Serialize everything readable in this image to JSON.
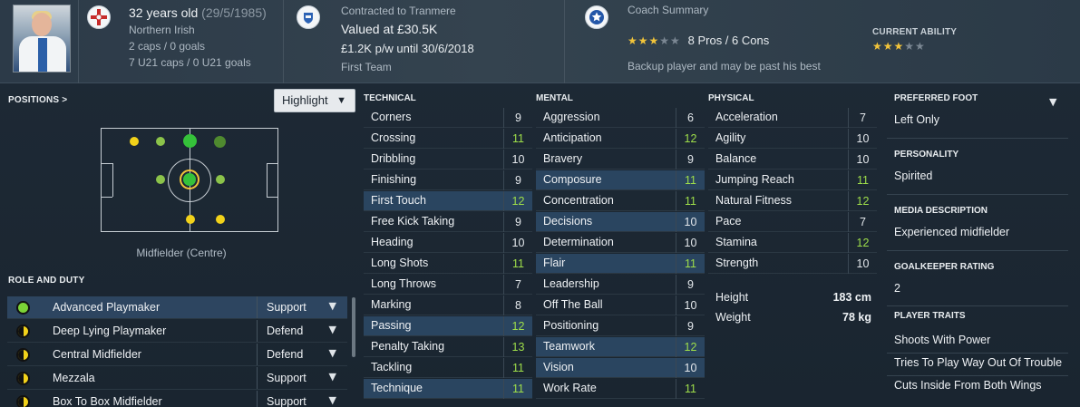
{
  "header": {
    "age": "32 years old",
    "dob": "(29/5/1985)",
    "nationality": "Northern Irish",
    "caps": "2 caps / 0 goals",
    "u21_caps": "7 U21 caps / 0 U21 goals",
    "contract_label": "Contracted to Tranmere",
    "value": "Valued at £30.5K",
    "wage": "£1.2K p/w until 30/6/2018",
    "squad": "First Team",
    "coach_title": "Coach Summary",
    "coach_stars": 3,
    "pros_cons": "8 Pros / 6 Cons",
    "coach_note": "Backup player and may be past his best",
    "ability_label": "CURRENT ABILITY",
    "ability_stars": 3
  },
  "positions": {
    "label": "POSITIONS",
    "label_chevron": ">",
    "highlight": "Highlight",
    "position_name": "Midfielder (Centre)"
  },
  "role": {
    "label": "ROLE AND DUTY",
    "roles": [
      {
        "name": "Advanced Playmaker",
        "duty": "Support"
      },
      {
        "name": "Deep Lying Playmaker",
        "duty": "Defend"
      },
      {
        "name": "Central Midfielder",
        "duty": "Defend"
      },
      {
        "name": "Mezzala",
        "duty": "Support"
      },
      {
        "name": "Box To Box Midfielder",
        "duty": "Support"
      }
    ]
  },
  "technical": {
    "label": "TECHNICAL",
    "attrs": [
      {
        "name": "Corners",
        "value": "9"
      },
      {
        "name": "Crossing",
        "value": "11"
      },
      {
        "name": "Dribbling",
        "value": "10"
      },
      {
        "name": "Finishing",
        "value": "9"
      },
      {
        "name": "First Touch",
        "value": "12"
      },
      {
        "name": "Free Kick Taking",
        "value": "9"
      },
      {
        "name": "Heading",
        "value": "10"
      },
      {
        "name": "Long Shots",
        "value": "11"
      },
      {
        "name": "Long Throws",
        "value": "7"
      },
      {
        "name": "Marking",
        "value": "8"
      },
      {
        "name": "Passing",
        "value": "12"
      },
      {
        "name": "Penalty Taking",
        "value": "13"
      },
      {
        "name": "Tackling",
        "value": "11"
      },
      {
        "name": "Technique",
        "value": "11"
      }
    ]
  },
  "mental": {
    "label": "MENTAL",
    "attrs": [
      {
        "name": "Aggression",
        "value": "6"
      },
      {
        "name": "Anticipation",
        "value": "12"
      },
      {
        "name": "Bravery",
        "value": "9"
      },
      {
        "name": "Composure",
        "value": "11"
      },
      {
        "name": "Concentration",
        "value": "11"
      },
      {
        "name": "Decisions",
        "value": "10"
      },
      {
        "name": "Determination",
        "value": "10"
      },
      {
        "name": "Flair",
        "value": "11"
      },
      {
        "name": "Leadership",
        "value": "9"
      },
      {
        "name": "Off The Ball",
        "value": "10"
      },
      {
        "name": "Positioning",
        "value": "9"
      },
      {
        "name": "Teamwork",
        "value": "12"
      },
      {
        "name": "Vision",
        "value": "10"
      },
      {
        "name": "Work Rate",
        "value": "11"
      }
    ]
  },
  "physical": {
    "label": "PHYSICAL",
    "attrs": [
      {
        "name": "Acceleration",
        "value": "7"
      },
      {
        "name": "Agility",
        "value": "10"
      },
      {
        "name": "Balance",
        "value": "10"
      },
      {
        "name": "Jumping Reach",
        "value": "11"
      },
      {
        "name": "Natural Fitness",
        "value": "12"
      },
      {
        "name": "Pace",
        "value": "7"
      },
      {
        "name": "Stamina",
        "value": "12"
      },
      {
        "name": "Strength",
        "value": "10"
      }
    ],
    "height_label": "Height",
    "height": "183 cm",
    "weight_label": "Weight",
    "weight": "78 kg"
  },
  "info": {
    "foot_label": "PREFERRED FOOT",
    "foot": "Left Only",
    "personality_label": "PERSONALITY",
    "personality": "Spirited",
    "media_label": "MEDIA DESCRIPTION",
    "media": "Experienced midfielder",
    "gk_label": "GOALKEEPER RATING",
    "gk": "2",
    "traits_label": "PLAYER TRAITS",
    "traits": [
      "Shoots With Power",
      "Tries To Play Way Out Of Trouble",
      "Cuts Inside From Both Wings"
    ]
  },
  "colors": {
    "good": "#9ede4a",
    "accent": "#2a4560",
    "star": "#f2c43a"
  }
}
